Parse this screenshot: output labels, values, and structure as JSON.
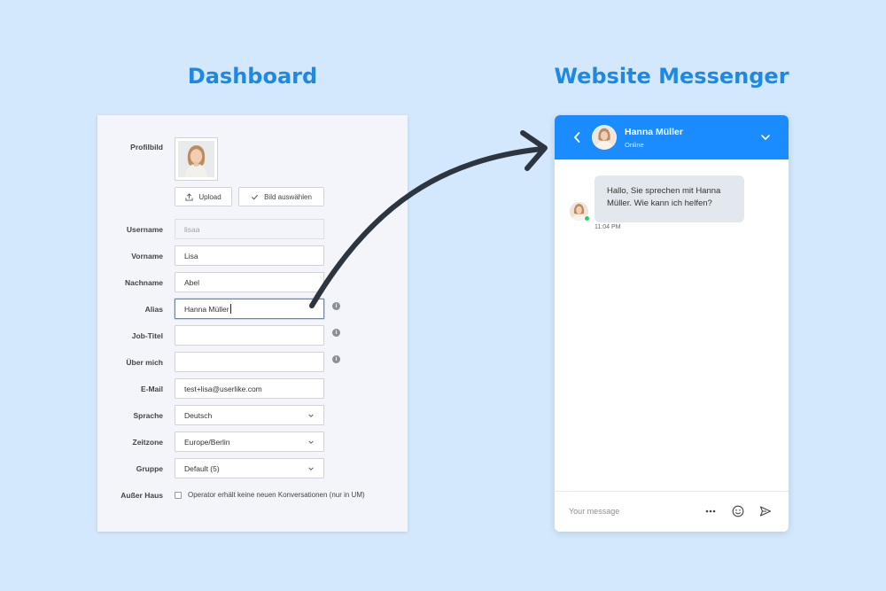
{
  "headings": {
    "dashboard": "Dashboard",
    "messenger": "Website Messenger"
  },
  "dashboard": {
    "profile_label": "Profilbild",
    "upload_button": "Upload",
    "choose_image_button": "Bild auswählen",
    "fields": {
      "username": {
        "label": "Username",
        "value": "lisaa"
      },
      "firstname": {
        "label": "Vorname",
        "value": "Lisa"
      },
      "lastname": {
        "label": "Nachname",
        "value": "Abel"
      },
      "alias": {
        "label": "Alias",
        "value": "Hanna Müller"
      },
      "jobtitle": {
        "label": "Job-Titel",
        "value": ""
      },
      "about": {
        "label": "Über mich",
        "value": ""
      },
      "email": {
        "label": "E-Mail",
        "value": "test+lisa@userlike.com"
      },
      "language": {
        "label": "Sprache",
        "value": "Deutsch"
      },
      "timezone": {
        "label": "Zeitzone",
        "value": "Europe/Berlin"
      },
      "group": {
        "label": "Gruppe",
        "value": "Default (5)"
      }
    },
    "away": {
      "label": "Außer Haus",
      "checkbox_text": "Operator erhält keine neuen Konversationen (nur in UM)",
      "checked": false
    }
  },
  "messenger": {
    "header_color": "#1a8cff",
    "operator_name": "Hanna Müller",
    "operator_status": "Online",
    "message_text": "Hallo, Sie sprechen mit Hanna Müller. Wie kann ich helfen?",
    "message_time": "11:04 PM",
    "input_placeholder": "Your message",
    "icons": [
      "back-icon",
      "chevron-down-icon",
      "more-icon",
      "emoji-icon",
      "send-icon"
    ]
  },
  "colors": {
    "background": "#d3e8fc",
    "heading": "#1e88e5",
    "arrow": "#2d3540",
    "online": "#2ecc71"
  }
}
